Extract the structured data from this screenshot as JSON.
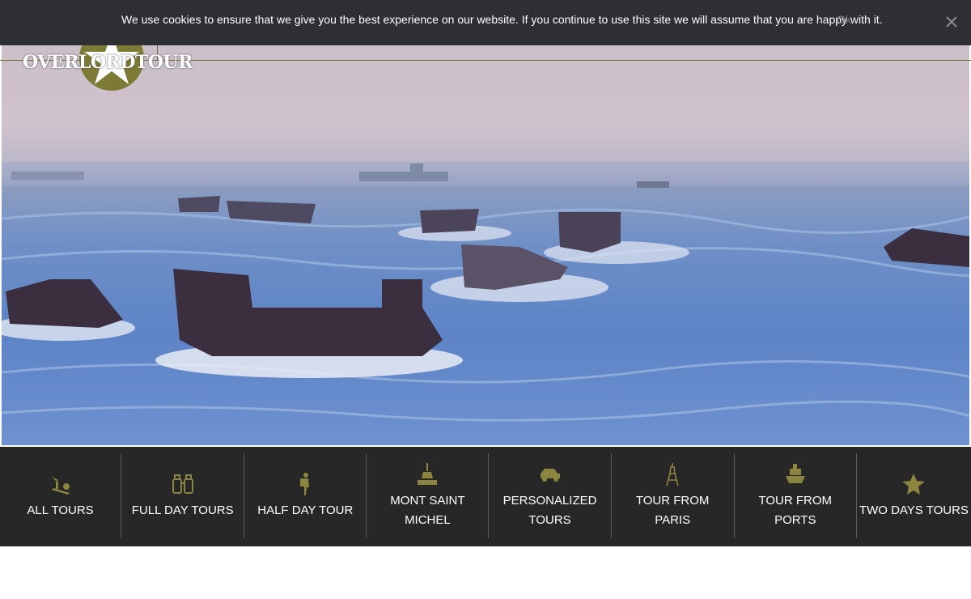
{
  "cookie": {
    "message": "We use cookies to ensure that we give you the best experience on our website. If you continue to use this site we will assume that you are happy with it.",
    "ok_label": "Ok",
    "close_icon": "close-icon"
  },
  "brand": {
    "logo_text": "OVERLORDTOUR",
    "logo_icon": "star-icon",
    "accent": "#7d7a36"
  },
  "tours": [
    {
      "label": "ALL TOURS",
      "icon": "scooter-icon"
    },
    {
      "label": "FULL DAY TOURS",
      "icon": "binoculars-icon"
    },
    {
      "label": "HALF DAY TOUR",
      "icon": "hiker-icon"
    },
    {
      "label": "MONT SAINT\nMICHEL",
      "icon": "abbey-icon"
    },
    {
      "label": "PERSONALIZED\nTOURS",
      "icon": "jeep-icon"
    },
    {
      "label": "TOUR FROM\nPARIS",
      "icon": "eiffel-tower-icon"
    },
    {
      "label": "TOUR FROM\nPORTS",
      "icon": "cruise-ship-icon"
    },
    {
      "label": "TWO DAYS TOURS",
      "icon": "star-icon"
    }
  ],
  "colors": {
    "nav_bg": "#272727",
    "icon": "#8c853f",
    "cookie_bg": "#2e2f33"
  }
}
